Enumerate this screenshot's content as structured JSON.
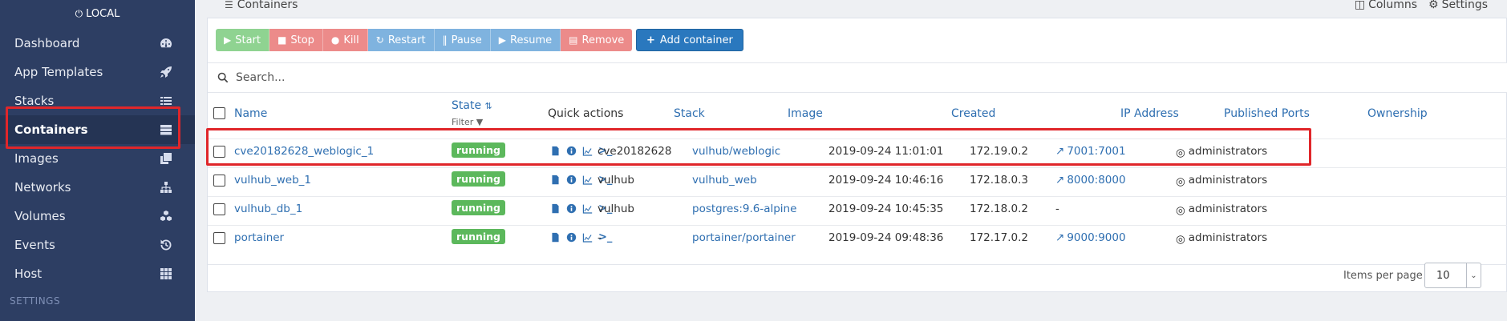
{
  "sidebar": {
    "endpoint": "LOCAL",
    "items": [
      {
        "label": "Dashboard",
        "icon": "tachometer-icon"
      },
      {
        "label": "App Templates",
        "icon": "rocket-icon"
      },
      {
        "label": "Stacks",
        "icon": "list-icon"
      },
      {
        "label": "Containers",
        "icon": "server-icon"
      },
      {
        "label": "Images",
        "icon": "clone-icon"
      },
      {
        "label": "Networks",
        "icon": "sitemap-icon"
      },
      {
        "label": "Volumes",
        "icon": "cubes-icon"
      },
      {
        "label": "Events",
        "icon": "history-icon"
      },
      {
        "label": "Host",
        "icon": "th-icon"
      }
    ],
    "settings_heading": "SETTINGS",
    "active": "Containers"
  },
  "header": {
    "title": "Containers",
    "columns_label": "Columns",
    "settings_label": "Settings"
  },
  "toolbar": {
    "start": "Start",
    "stop": "Stop",
    "kill": "Kill",
    "restart": "Restart",
    "pause": "Pause",
    "resume": "Resume",
    "remove": "Remove",
    "add": "Add container"
  },
  "search": {
    "placeholder": "Search..."
  },
  "table": {
    "headers": {
      "name": "Name",
      "state": "State",
      "state_filter": "Filter",
      "quick_actions": "Quick actions",
      "stack": "Stack",
      "image": "Image",
      "created": "Created",
      "ip": "IP Address",
      "ports": "Published Ports",
      "ownership": "Ownership"
    },
    "rows": [
      {
        "name": "cve20182628_weblogic_1",
        "state": "running",
        "stack": "cve20182628",
        "image": "vulhub/weblogic",
        "created": "2019-09-24 11:01:01",
        "ip": "172.19.0.2",
        "ports": "7001:7001",
        "ownership": "administrators"
      },
      {
        "name": "vulhub_web_1",
        "state": "running",
        "stack": "vulhub",
        "image": "vulhub_web",
        "created": "2019-09-24 10:46:16",
        "ip": "172.18.0.3",
        "ports": "8000:8000",
        "ownership": "administrators"
      },
      {
        "name": "vulhub_db_1",
        "state": "running",
        "stack": "vulhub",
        "image": "postgres:9.6-alpine",
        "created": "2019-09-24 10:45:35",
        "ip": "172.18.0.2",
        "ports": "-",
        "ownership": "administrators"
      },
      {
        "name": "portainer",
        "state": "running",
        "stack": "-",
        "image": "portainer/portainer",
        "created": "2019-09-24 09:48:36",
        "ip": "172.17.0.2",
        "ports": "9000:9000",
        "ownership": "administrators"
      }
    ]
  },
  "pagination": {
    "label": "Items per page",
    "value": "10"
  },
  "colors": {
    "sidebar_bg": "#2d3e63",
    "sidebar_active": "#253454",
    "link": "#2f6fb1",
    "running": "#5cb85c",
    "annotation": "#e0262a"
  }
}
